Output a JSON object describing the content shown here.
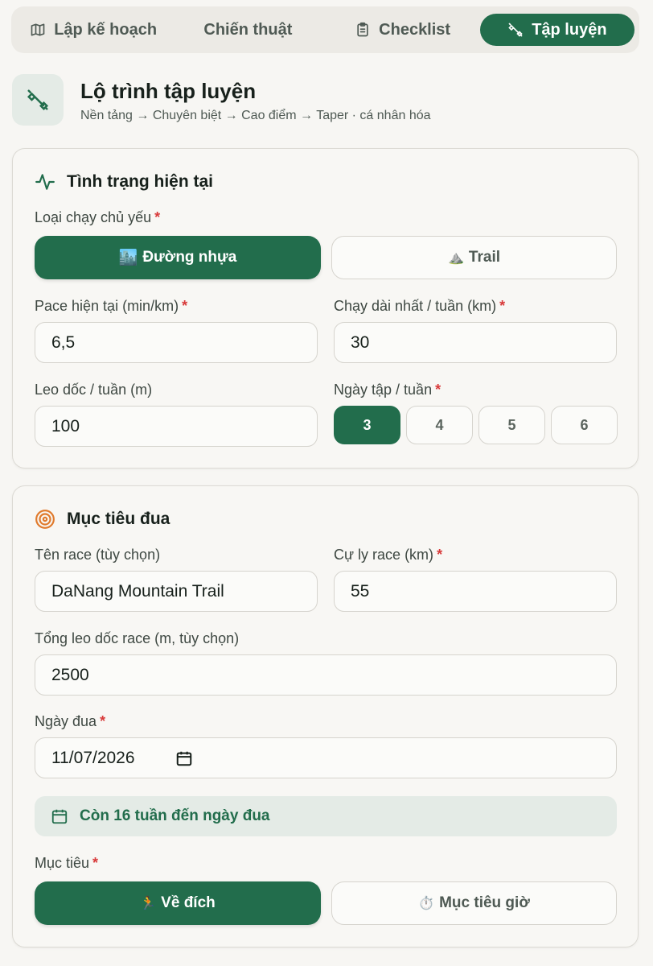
{
  "tabs": [
    {
      "label": "Lập kế hoạch",
      "icon": "map-icon"
    },
    {
      "label": "Chiến thuật",
      "icon": ""
    },
    {
      "label": "Checklist",
      "icon": "clipboard-icon"
    },
    {
      "label": "Tập luyện",
      "icon": "dumbbell-icon",
      "active": true
    }
  ],
  "header": {
    "title": "Lộ trình tập luyện",
    "subtitle": "Nền tảng → Chuyên biệt → Cao điểm → Taper · cá nhân hóa"
  },
  "current": {
    "title": "Tình trạng hiện tại",
    "run_type_label": "Loại chạy chủ yếu",
    "road_label": "Đường nhựa",
    "trail_label": "Trail",
    "pace_label": "Pace hiện tại (min/km)",
    "pace_value": "6,5",
    "long_label": "Chạy dài nhất / tuần (km)",
    "long_value": "30",
    "elev_label": "Leo dốc / tuần (m)",
    "elev_value": "100",
    "days_label": "Ngày tập / tuần",
    "days": [
      "3",
      "4",
      "5",
      "6"
    ],
    "days_selected": "3"
  },
  "goal": {
    "title": "Mục tiêu đua",
    "race_name_label": "Tên race (tùy chọn)",
    "race_name_value": "DaNang Mountain Trail",
    "distance_label": "Cự ly race (km)",
    "distance_value": "55",
    "total_elev_label": "Tổng leo dốc race (m, tùy chọn)",
    "total_elev_value": "2500",
    "date_label": "Ngày đua",
    "date_value": "11/07/2026",
    "info_prefix": "Còn",
    "info_weeks": "16",
    "info_suffix": "tuần đến ngày đua",
    "target_label": "Mục tiêu",
    "finish_label": "Về đích",
    "time_label": "Mục tiêu giờ"
  },
  "required_mark": "*",
  "colors": {
    "primary": "#226d4c",
    "required": "#d83a3a",
    "accent_target": "#e07a2c"
  }
}
